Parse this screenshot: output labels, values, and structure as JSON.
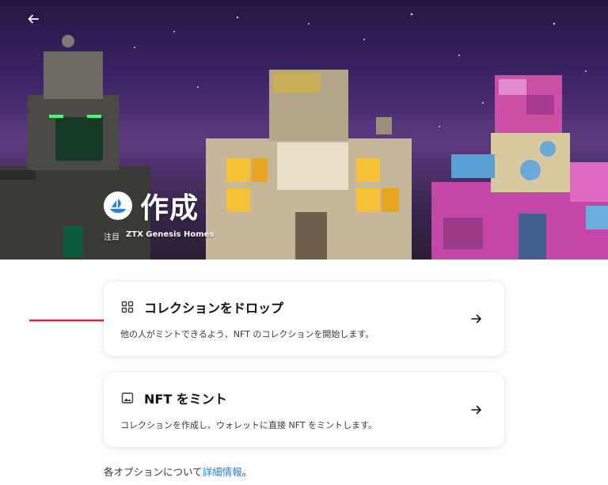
{
  "hero": {
    "title": "作成",
    "featured_label": "注目",
    "featured_name": "ZTX Genesis Homes"
  },
  "options": [
    {
      "title": "コレクションをドロップ",
      "description": "他の人がミントできるよう、NFT のコレクションを開始します。",
      "icon": "grid-icon"
    },
    {
      "title": "NFT をミント",
      "description": "コレクションを作成し、ウォレットに直接 NFT をミントします。",
      "icon": "image-icon"
    }
  ],
  "footer": {
    "prefix": "各オプションについて",
    "link": "詳細情報",
    "suffix": "。"
  },
  "colors": {
    "link": "#2081e2",
    "annotation_arrow": "#d0253a"
  }
}
